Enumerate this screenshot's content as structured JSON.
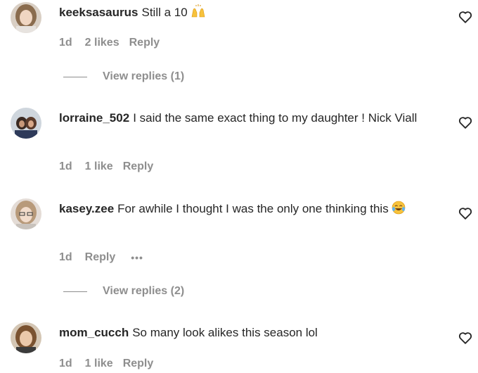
{
  "comments": [
    {
      "username": "keeksasaurus",
      "text": "Still a 10",
      "emoji": "raising-hands-emoji",
      "time": "1d",
      "likes": "2 likes",
      "reply_label": "Reply",
      "view_replies": "View replies (1)"
    },
    {
      "username": "lorraine_502",
      "text": "I said the same exact thing to my daughter ! Nick Viall",
      "time": "1d",
      "likes": "1 like",
      "reply_label": "Reply"
    },
    {
      "username": "kasey.zee",
      "text": "For awhile I thought I was the only one thinking this",
      "emoji": "tears-of-joy-emoji",
      "time": "1d",
      "reply_label": "Reply",
      "more": "•••",
      "view_replies": "View replies (2)"
    },
    {
      "username": "mom_cucch",
      "text": "So many look alikes this season lol",
      "time": "1d",
      "likes": "1 like",
      "reply_label": "Reply"
    }
  ],
  "icons": {
    "like": "heart-outline-icon"
  },
  "colors": {
    "text": "#262626",
    "secondary": "#8e8e8e"
  }
}
